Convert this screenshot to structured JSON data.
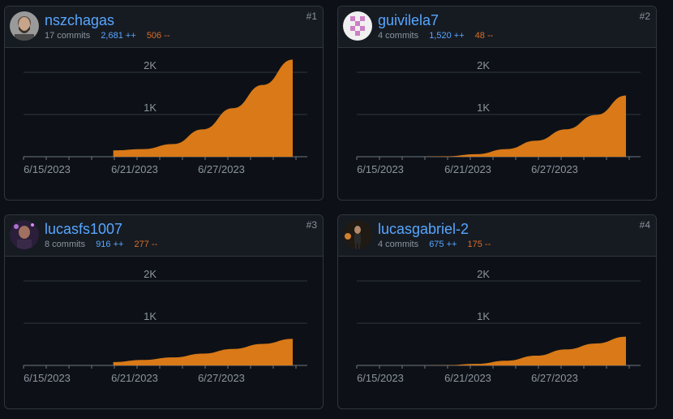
{
  "theme": {
    "background": "#0d1117",
    "card_header": "#161b22",
    "border": "#30363d",
    "link": "#58a6ff",
    "additions": "#58a6ff",
    "deletions": "#db6d28",
    "muted": "#8b949e",
    "area_fill": "#d97917",
    "grid": "#30363d"
  },
  "contributors": [
    {
      "rank": "#1",
      "username": "nszchagas",
      "commits": "17 commits",
      "additions": "2,681 ++",
      "deletions": "506 --",
      "avatar_icon": "person-avatar-icon"
    },
    {
      "rank": "#2",
      "username": "guivilela7",
      "commits": "4 commits",
      "additions": "1,520 ++",
      "deletions": "48 --",
      "avatar_icon": "identicon-avatar-icon"
    },
    {
      "rank": "#3",
      "username": "lucasfs1007",
      "commits": "8 commits",
      "additions": "916 ++",
      "deletions": "277 --",
      "avatar_icon": "person-avatar-icon"
    },
    {
      "rank": "#4",
      "username": "lucasgabriel-2",
      "commits": "4 commits",
      "additions": "675 ++",
      "deletions": "175 --",
      "avatar_icon": "person-avatar-icon"
    }
  ],
  "chart_data": [
    {
      "type": "area",
      "x": [
        "6/13/2023",
        "6/15/2023",
        "6/17/2023",
        "6/19/2023",
        "6/21/2023",
        "6/23/2023",
        "6/25/2023",
        "6/27/2023",
        "6/29/2023",
        "7/1/2023"
      ],
      "series": [
        {
          "values": [
            null,
            null,
            null,
            150,
            180,
            300,
            650,
            1150,
            1700,
            2300
          ]
        }
      ],
      "x_tick_labels": [
        "6/15/2023",
        "6/21/2023",
        "6/27/2023"
      ],
      "y_tick_labels": [
        "1K",
        "2K"
      ],
      "ylim": [
        0,
        2500
      ],
      "grid": true
    },
    {
      "type": "area",
      "x": [
        "6/13/2023",
        "6/15/2023",
        "6/17/2023",
        "6/19/2023",
        "6/21/2023",
        "6/23/2023",
        "6/25/2023",
        "6/27/2023",
        "6/29/2023",
        "7/1/2023"
      ],
      "series": [
        {
          "values": [
            0,
            0,
            0,
            10,
            60,
            180,
            380,
            650,
            990,
            1450
          ]
        }
      ],
      "x_tick_labels": [
        "6/15/2023",
        "6/21/2023",
        "6/27/2023"
      ],
      "y_tick_labels": [
        "1K",
        "2K"
      ],
      "ylim": [
        0,
        2500
      ],
      "grid": true
    },
    {
      "type": "area",
      "x": [
        "6/13/2023",
        "6/15/2023",
        "6/17/2023",
        "6/19/2023",
        "6/21/2023",
        "6/23/2023",
        "6/25/2023",
        "6/27/2023",
        "6/29/2023",
        "7/1/2023"
      ],
      "series": [
        {
          "values": [
            null,
            null,
            null,
            80,
            130,
            190,
            280,
            390,
            510,
            630
          ]
        }
      ],
      "x_tick_labels": [
        "6/15/2023",
        "6/21/2023",
        "6/27/2023"
      ],
      "y_tick_labels": [
        "1K",
        "2K"
      ],
      "ylim": [
        0,
        2500
      ],
      "grid": true
    },
    {
      "type": "area",
      "x": [
        "6/13/2023",
        "6/15/2023",
        "6/17/2023",
        "6/19/2023",
        "6/21/2023",
        "6/23/2023",
        "6/25/2023",
        "6/27/2023",
        "6/29/2023",
        "7/1/2023"
      ],
      "series": [
        {
          "values": [
            0,
            0,
            0,
            5,
            35,
            110,
            230,
            380,
            520,
            680
          ]
        }
      ],
      "x_tick_labels": [
        "6/15/2023",
        "6/21/2023",
        "6/27/2023"
      ],
      "y_tick_labels": [
        "1K",
        "2K"
      ],
      "ylim": [
        0,
        2500
      ],
      "grid": true
    }
  ]
}
